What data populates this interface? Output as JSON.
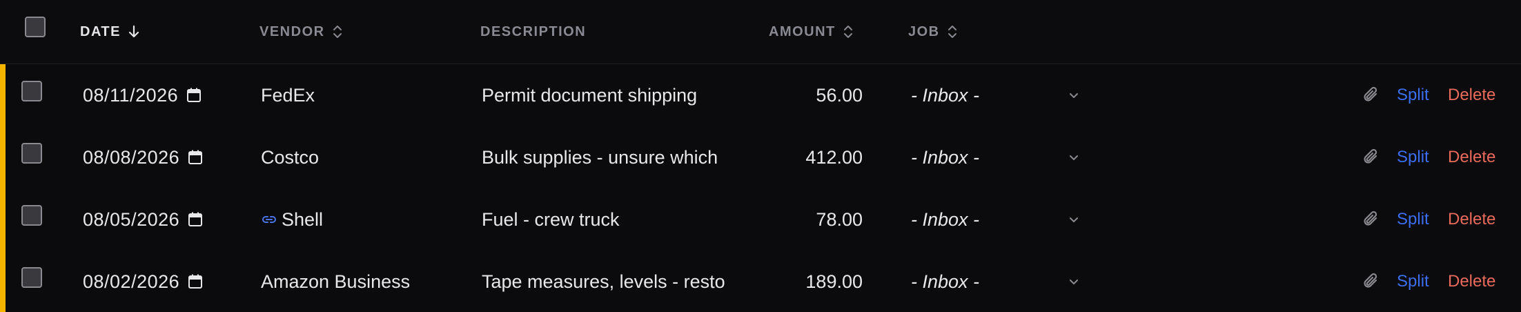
{
  "header": {
    "date_label": "DATE",
    "vendor_label": "VENDOR",
    "description_label": "DESCRIPTION",
    "amount_label": "AMOUNT",
    "job_label": "JOB"
  },
  "rows": [
    {
      "date": "08/11/2026",
      "vendor": "FedEx",
      "description": "Permit document shipping",
      "amount": "56.00",
      "job": "- Inbox -",
      "split": "Split",
      "delete": "Delete"
    },
    {
      "date": "08/08/2026",
      "vendor": "Costco",
      "description": "Bulk supplies - unsure which",
      "amount": "412.00",
      "job": "- Inbox -",
      "split": "Split",
      "delete": "Delete"
    },
    {
      "date": "08/05/2026",
      "vendor": "Shell",
      "description": "Fuel - crew truck",
      "amount": "78.00",
      "job": "- Inbox -",
      "split": "Split",
      "delete": "Delete"
    },
    {
      "date": "08/02/2026",
      "vendor": "Amazon Business",
      "description": "Tape measures, levels - resto",
      "amount": "189.00",
      "job": "- Inbox -",
      "split": "Split",
      "delete": "Delete"
    }
  ],
  "colors": {
    "accent": "#f5b400",
    "split": "#3b6ef0",
    "delete": "#ea6a5c",
    "link": "#4a74e8"
  },
  "icons": {
    "sort_active": "arrow-down-icon",
    "sort_inactive": "chevron-up-down-icon",
    "date": "calendar-icon",
    "vendor_link": "link-icon",
    "job_dropdown": "chevron-down-icon",
    "attachment": "paperclip-icon"
  }
}
